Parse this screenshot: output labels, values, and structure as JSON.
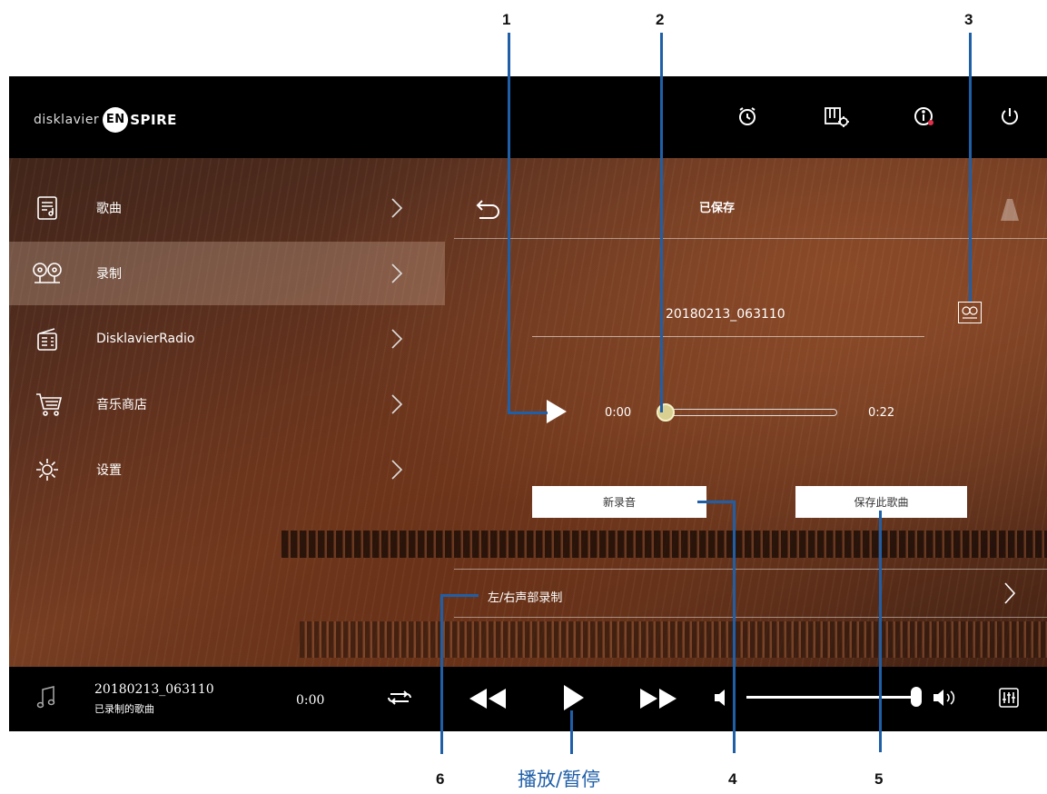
{
  "header": {
    "logo_prefix": "disklavier",
    "logo_en": "EN",
    "logo_suffix": "SPIRE",
    "icons": [
      "alarm-icon",
      "piano-settings-icon",
      "info-icon",
      "power-icon"
    ]
  },
  "sidebar": {
    "items": [
      {
        "label": "歌曲",
        "icon": "song-list-icon",
        "active": false
      },
      {
        "label": "录制",
        "icon": "reel-recorder-icon",
        "active": true
      },
      {
        "label": "DisklavierRadio",
        "icon": "radio-icon",
        "active": false
      },
      {
        "label": "音乐商店",
        "icon": "shopping-cart-icon",
        "active": false
      },
      {
        "label": "设置",
        "icon": "gear-icon",
        "active": false
      }
    ]
  },
  "main": {
    "title": "已保存",
    "filename": "20180213_063110",
    "time_start": "0:00",
    "time_end": "0:22",
    "progress": 0.0,
    "new_recording_label": "新录音",
    "save_song_label": "保存此歌曲",
    "left_right_label": "左/右声部录制"
  },
  "player": {
    "song_title": "20180213_063110",
    "song_subtitle": "已录制的歌曲",
    "current_time": "0:00",
    "volume": 1.0
  },
  "callouts": {
    "n1": "1",
    "n2": "2",
    "n3": "3",
    "n4": "4",
    "n5": "5",
    "n6": "6",
    "play_pause": "播放/暂停"
  },
  "colors": {
    "callout_line": "#1f5fa8",
    "progress_knob": "#d8d090",
    "active_row": "rgba(200,170,150,0.35)"
  }
}
